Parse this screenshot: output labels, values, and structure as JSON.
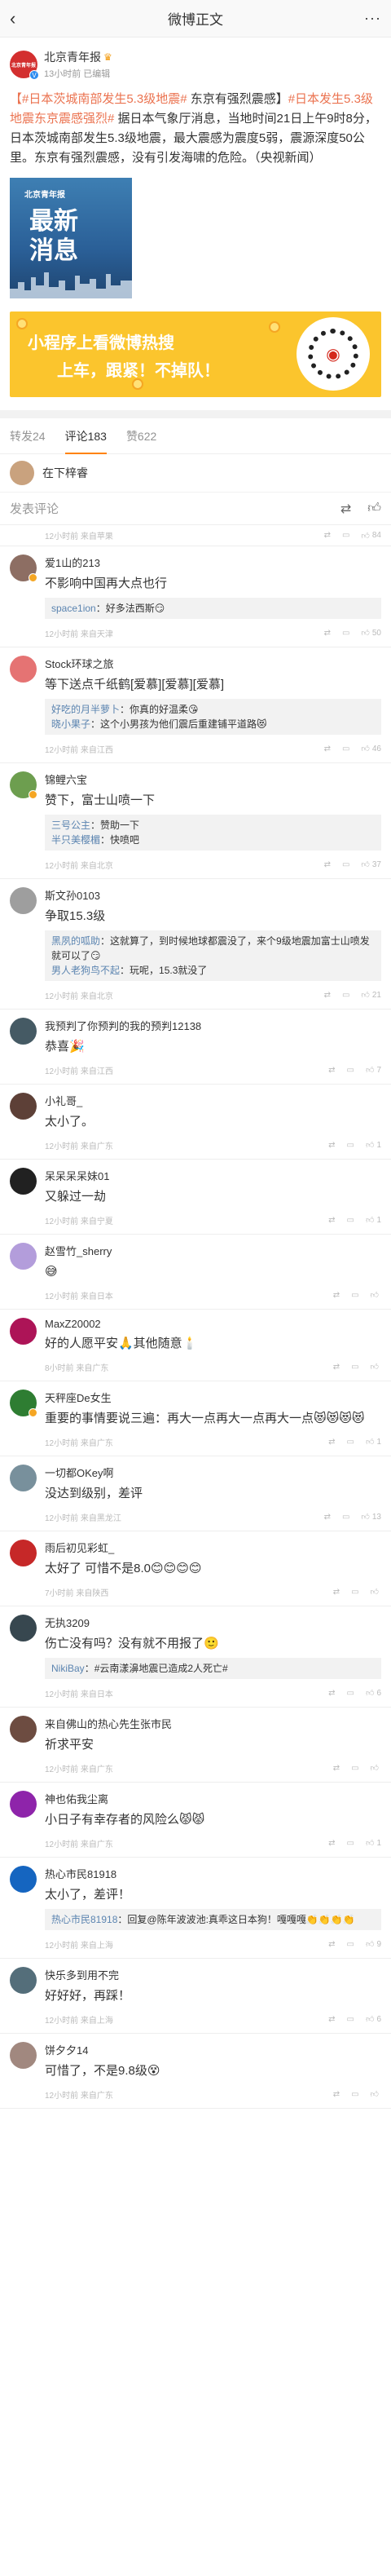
{
  "nav": {
    "back": "‹",
    "title": "微博正文",
    "more": "···"
  },
  "author": {
    "avatar_text": "北京青年报",
    "name": "北京青年报",
    "sub": "13小时前 已编辑"
  },
  "post": {
    "tag1": "【#日本茨城南部发生5.3级地震#",
    "plain1": " 东京有强烈震感】",
    "tag2": "#日本发生5.3级地震东京震感强烈#",
    "body": " 据日本气象厅消息，当地时间21日上午9时8分，日本茨城南部发生5.3级地震，最大震感为震度5弱，震源深度50公里。东京有强烈震感，没有引发海啸的危险。（央视新闻）",
    "image_brand": "北京青年报",
    "image_big_1": "最新",
    "image_big_2": "消息"
  },
  "banner": {
    "line1": "小程序上看微博热搜",
    "line2": "上车，跟紧！不掉队！"
  },
  "tabs": [
    {
      "label": "转发24",
      "active": false
    },
    {
      "label": "评论183",
      "active": true
    },
    {
      "label": "赞622",
      "active": false
    }
  ],
  "liked_by": {
    "name": "在下梓睿"
  },
  "compose": {
    "placeholder": "发表评论"
  },
  "first_row": {
    "time": "12小时前 来自苹果",
    "likes": "84"
  },
  "comments": [
    {
      "name": "爱1山的213",
      "time": "12小时前 来自天津",
      "text": "不影响中国再大点也行",
      "replies": [
        {
          "user": "space1ion",
          "text": "好多法西斯😏"
        }
      ],
      "likes": "50",
      "avatar": "#8d6e63",
      "dot": "#f5a623"
    },
    {
      "name": "Stock环球之旅",
      "time": "12小时前 来自江西",
      "text": "等下送点千纸鹤[爱慕][爱慕][爱慕]",
      "replies": [
        {
          "user": "好吃的月半萝卜",
          "text": "你真的好温柔😘"
        },
        {
          "user": "晓小果子",
          "text": "这个小男孩为他们震后重建铺平道路😻"
        }
      ],
      "likes": "46",
      "avatar": "#e57373",
      "dot": ""
    },
    {
      "name": "锦鲤六宝",
      "time": "12小时前 来自北京",
      "text": "赞下，富士山喷一下",
      "replies": [
        {
          "user": "三号公主",
          "text": "赞助一下"
        },
        {
          "user": "半只美樱楣",
          "text": "快喷吧"
        }
      ],
      "likes": "37",
      "avatar": "#6d9e4f",
      "dot": "#f5a623"
    },
    {
      "name": "斯文孙0103",
      "time": "12小时前 来自北京",
      "text": "争取15.3级",
      "replies": [
        {
          "user": "黑夙的呱助",
          "text": "这就算了，到时候地球都震没了，来个9级地震加富士山喷发就可以了😏"
        },
        {
          "user": "男人老狗鸟不起",
          "text": "玩呢，15.3就没了"
        }
      ],
      "likes": "21",
      "avatar": "#9e9e9e",
      "dot": ""
    },
    {
      "name": "我预判了你预判的我的预判12138",
      "time": "12小时前 来自江西",
      "text": "恭喜🎉",
      "replies": [],
      "likes": "7",
      "avatar": "#455a64",
      "dot": ""
    },
    {
      "name": "小礼哥_",
      "time": "12小时前 来自广东",
      "text": "太小了。",
      "replies": [],
      "likes": "1",
      "avatar": "#5d4037",
      "dot": ""
    },
    {
      "name": "呆呆呆呆妹01",
      "time": "12小时前 来自宁夏",
      "text": "又躲过一劫",
      "replies": [],
      "likes": "1",
      "avatar": "#212121",
      "dot": ""
    },
    {
      "name": "赵雪竹_sherry",
      "time": "12小时前 来自日本",
      "text": "😅",
      "replies": [],
      "likes": "",
      "avatar": "#b39ddb",
      "dot": ""
    },
    {
      "name": "MaxZ20002",
      "time": "8小时前 来自广东",
      "text": "好的人愿平安🙏其他随意🕯️",
      "replies": [],
      "likes": "",
      "avatar": "#ad1457",
      "dot": ""
    },
    {
      "name": "天秤座De女生",
      "time": "12小时前 来自广东",
      "text": "重要的事情要说三遍：再大一点再大一点再大一点😻😻😻😻",
      "replies": [],
      "likes": "1",
      "avatar": "#2e7d32",
      "dot": "#f5a623"
    },
    {
      "name": "一切都OKey啊",
      "time": "12小时前 来自黑龙江",
      "text": "没达到级别，差评",
      "replies": [],
      "likes": "13",
      "avatar": "#78909c",
      "dot": ""
    },
    {
      "name": "雨后初见彩虹_",
      "time": "7小时前 来自陕西",
      "text": "太好了 可惜不是8.0😊😊😊😊",
      "replies": [],
      "likes": "",
      "avatar": "#c62828",
      "dot": ""
    },
    {
      "name": "无执3209",
      "time": "12小时前 来自日本",
      "text": "伤亡没有吗？没有就不用报了🙂",
      "replies": [
        {
          "user": "NikiBay",
          "text": "#云南漾濞地震已造成2人死亡#"
        }
      ],
      "likes": "6",
      "avatar": "#37474f",
      "dot": ""
    },
    {
      "name": "来自佛山的热心先生张市民",
      "time": "12小时前 来自广东",
      "text": "祈求平安",
      "replies": [],
      "likes": "",
      "avatar": "#6d4c41",
      "dot": ""
    },
    {
      "name": "神也佑我尘离",
      "time": "12小时前 来自广东",
      "text": "小日子有幸存者的风险么😾😾",
      "replies": [],
      "likes": "1",
      "avatar": "#8e24aa",
      "dot": ""
    },
    {
      "name": "热心市民81918",
      "time": "12小时前 来自上海",
      "text": "太小了，差评！",
      "replies": [
        {
          "user": "热心市民81918",
          "text": "回复@陈年波波池:真乖这日本狗！嘎嘎嘎👏👏👏👏"
        }
      ],
      "likes": "9",
      "avatar": "#1565c0",
      "dot": ""
    },
    {
      "name": "快乐多到用不完",
      "time": "12小时前 来自上海",
      "text": "好好好，再踩！",
      "replies": [],
      "likes": "6",
      "avatar": "#546e7a",
      "dot": ""
    },
    {
      "name": "饼夕夕14",
      "time": "12小时前 来自广东",
      "text": "可惜了，不是9.8级😵",
      "replies": [],
      "likes": "",
      "avatar": "#a1887f",
      "dot": ""
    }
  ],
  "icons": {
    "like": "thumbs-up-icon",
    "repost": "repost-icon",
    "comment": "comment-icon"
  },
  "colors": {
    "accent": "#ff8200",
    "link": "#eb7350",
    "reply_user": "#5b84b0"
  }
}
